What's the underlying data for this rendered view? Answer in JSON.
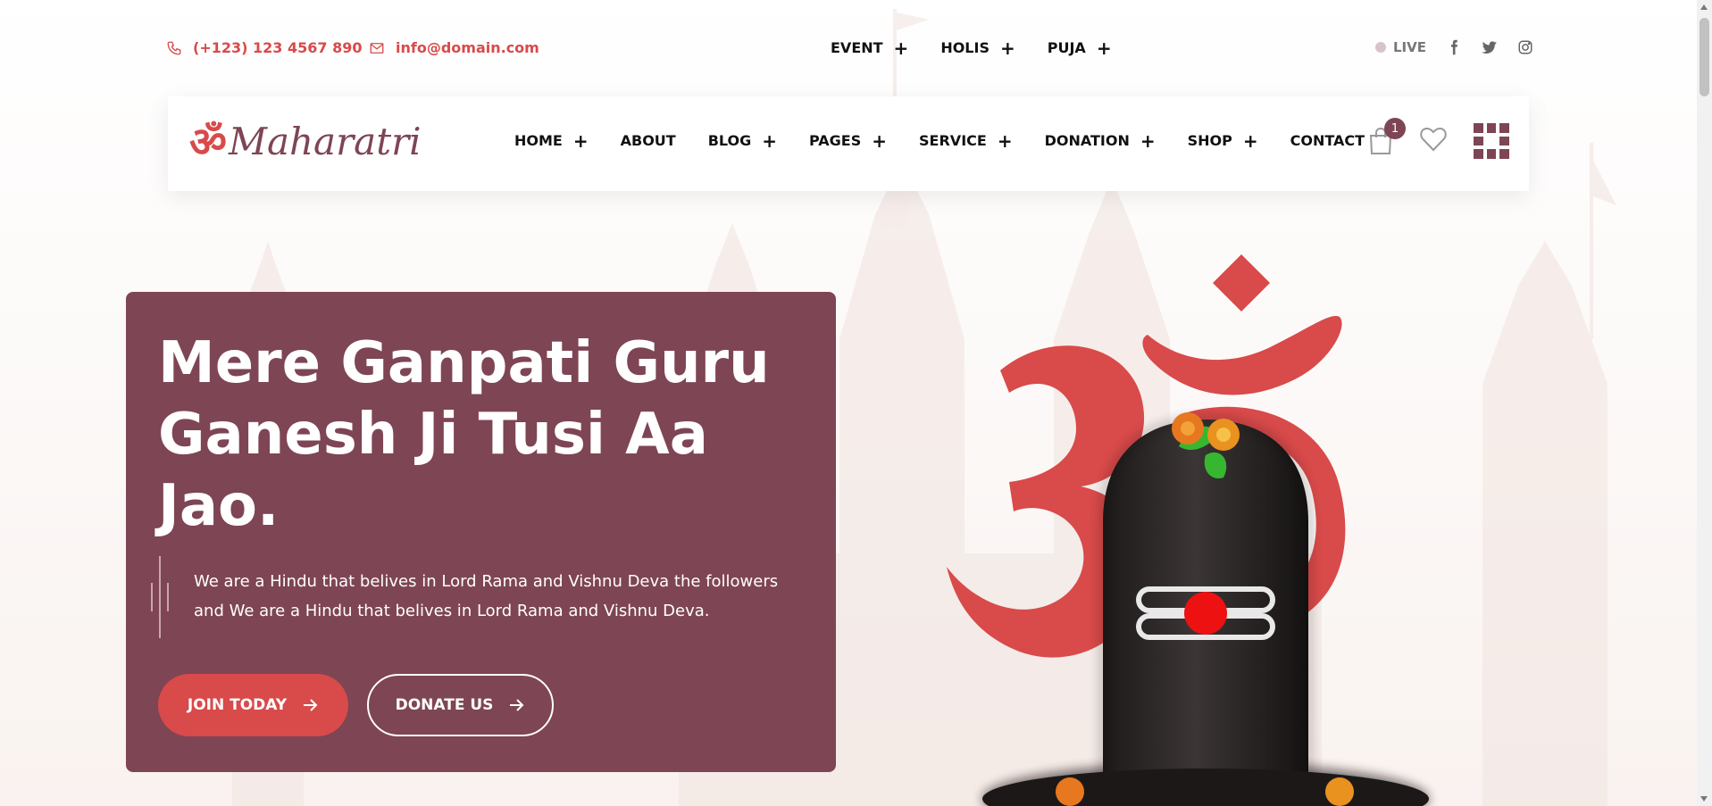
{
  "colors": {
    "accent": "#d94a4a",
    "brand": "#7e4554",
    "text": "#111111"
  },
  "topbar": {
    "phone": {
      "icon": "phone-icon",
      "text": "(+123) 123 4567 890"
    },
    "email": {
      "icon": "mail-icon",
      "text": "info@domain.com"
    },
    "menu": [
      {
        "label": "EVENT"
      },
      {
        "label": "HOLIS"
      },
      {
        "label": "PUJA"
      }
    ],
    "live_label": "LIVE",
    "social_icons": [
      "facebook-icon",
      "twitter-icon",
      "instagram-icon"
    ]
  },
  "header": {
    "logo_symbol": "ॐ",
    "logo_text": "Maharatri",
    "nav": [
      {
        "label": "HOME",
        "has_submenu": true
      },
      {
        "label": "ABOUT",
        "has_submenu": false
      },
      {
        "label": "BLOG",
        "has_submenu": true
      },
      {
        "label": "PAGES",
        "has_submenu": true
      },
      {
        "label": "SERVICE",
        "has_submenu": true
      },
      {
        "label": "DONATION",
        "has_submenu": true
      },
      {
        "label": "SHOP",
        "has_submenu": true
      },
      {
        "label": "CONTACT",
        "has_submenu": false
      }
    ],
    "cart_count": "1"
  },
  "hero": {
    "title": "Mere Ganpati Guru Ganesh Ji Tusi Aa Jao.",
    "description": "We are a Hindu that belives in Lord Rama and Vishnu Deva the followers and We are a Hindu that belives in Lord Rama and Vishnu Deva.",
    "join_button": "JOIN TODAY",
    "donate_button": "DONATE US"
  }
}
